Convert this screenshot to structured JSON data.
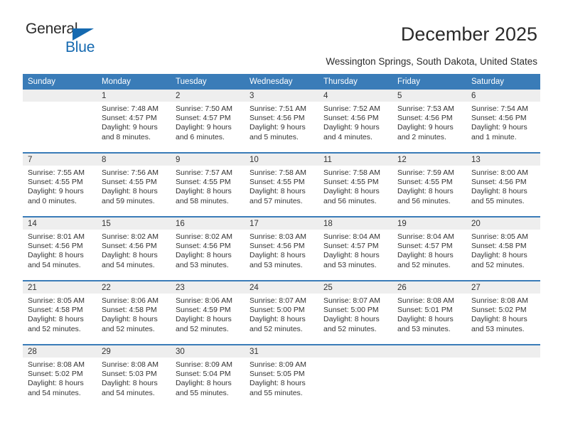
{
  "brand": {
    "name_top": "General",
    "name_bottom": "Blue",
    "accent_color": "#1569b0"
  },
  "header": {
    "title": "December 2025",
    "subtitle": "Wessington Springs, South Dakota, United States"
  },
  "calendar": {
    "header_bg": "#3a7cb8",
    "daynum_bg": "#eeeeee",
    "weekday_labels": [
      "Sunday",
      "Monday",
      "Tuesday",
      "Wednesday",
      "Thursday",
      "Friday",
      "Saturday"
    ],
    "weeks": [
      [
        {
          "day": "",
          "sunrise": "",
          "sunset": "",
          "daylight": "",
          "empty": true
        },
        {
          "day": "1",
          "sunrise": "Sunrise: 7:48 AM",
          "sunset": "Sunset: 4:57 PM",
          "daylight": "Daylight: 9 hours and 8 minutes."
        },
        {
          "day": "2",
          "sunrise": "Sunrise: 7:50 AM",
          "sunset": "Sunset: 4:57 PM",
          "daylight": "Daylight: 9 hours and 6 minutes."
        },
        {
          "day": "3",
          "sunrise": "Sunrise: 7:51 AM",
          "sunset": "Sunset: 4:56 PM",
          "daylight": "Daylight: 9 hours and 5 minutes."
        },
        {
          "day": "4",
          "sunrise": "Sunrise: 7:52 AM",
          "sunset": "Sunset: 4:56 PM",
          "daylight": "Daylight: 9 hours and 4 minutes."
        },
        {
          "day": "5",
          "sunrise": "Sunrise: 7:53 AM",
          "sunset": "Sunset: 4:56 PM",
          "daylight": "Daylight: 9 hours and 2 minutes."
        },
        {
          "day": "6",
          "sunrise": "Sunrise: 7:54 AM",
          "sunset": "Sunset: 4:56 PM",
          "daylight": "Daylight: 9 hours and 1 minute."
        }
      ],
      [
        {
          "day": "7",
          "sunrise": "Sunrise: 7:55 AM",
          "sunset": "Sunset: 4:55 PM",
          "daylight": "Daylight: 9 hours and 0 minutes."
        },
        {
          "day": "8",
          "sunrise": "Sunrise: 7:56 AM",
          "sunset": "Sunset: 4:55 PM",
          "daylight": "Daylight: 8 hours and 59 minutes."
        },
        {
          "day": "9",
          "sunrise": "Sunrise: 7:57 AM",
          "sunset": "Sunset: 4:55 PM",
          "daylight": "Daylight: 8 hours and 58 minutes."
        },
        {
          "day": "10",
          "sunrise": "Sunrise: 7:58 AM",
          "sunset": "Sunset: 4:55 PM",
          "daylight": "Daylight: 8 hours and 57 minutes."
        },
        {
          "day": "11",
          "sunrise": "Sunrise: 7:58 AM",
          "sunset": "Sunset: 4:55 PM",
          "daylight": "Daylight: 8 hours and 56 minutes."
        },
        {
          "day": "12",
          "sunrise": "Sunrise: 7:59 AM",
          "sunset": "Sunset: 4:55 PM",
          "daylight": "Daylight: 8 hours and 56 minutes."
        },
        {
          "day": "13",
          "sunrise": "Sunrise: 8:00 AM",
          "sunset": "Sunset: 4:56 PM",
          "daylight": "Daylight: 8 hours and 55 minutes."
        }
      ],
      [
        {
          "day": "14",
          "sunrise": "Sunrise: 8:01 AM",
          "sunset": "Sunset: 4:56 PM",
          "daylight": "Daylight: 8 hours and 54 minutes."
        },
        {
          "day": "15",
          "sunrise": "Sunrise: 8:02 AM",
          "sunset": "Sunset: 4:56 PM",
          "daylight": "Daylight: 8 hours and 54 minutes."
        },
        {
          "day": "16",
          "sunrise": "Sunrise: 8:02 AM",
          "sunset": "Sunset: 4:56 PM",
          "daylight": "Daylight: 8 hours and 53 minutes."
        },
        {
          "day": "17",
          "sunrise": "Sunrise: 8:03 AM",
          "sunset": "Sunset: 4:56 PM",
          "daylight": "Daylight: 8 hours and 53 minutes."
        },
        {
          "day": "18",
          "sunrise": "Sunrise: 8:04 AM",
          "sunset": "Sunset: 4:57 PM",
          "daylight": "Daylight: 8 hours and 53 minutes."
        },
        {
          "day": "19",
          "sunrise": "Sunrise: 8:04 AM",
          "sunset": "Sunset: 4:57 PM",
          "daylight": "Daylight: 8 hours and 52 minutes."
        },
        {
          "day": "20",
          "sunrise": "Sunrise: 8:05 AM",
          "sunset": "Sunset: 4:58 PM",
          "daylight": "Daylight: 8 hours and 52 minutes."
        }
      ],
      [
        {
          "day": "21",
          "sunrise": "Sunrise: 8:05 AM",
          "sunset": "Sunset: 4:58 PM",
          "daylight": "Daylight: 8 hours and 52 minutes."
        },
        {
          "day": "22",
          "sunrise": "Sunrise: 8:06 AM",
          "sunset": "Sunset: 4:58 PM",
          "daylight": "Daylight: 8 hours and 52 minutes."
        },
        {
          "day": "23",
          "sunrise": "Sunrise: 8:06 AM",
          "sunset": "Sunset: 4:59 PM",
          "daylight": "Daylight: 8 hours and 52 minutes."
        },
        {
          "day": "24",
          "sunrise": "Sunrise: 8:07 AM",
          "sunset": "Sunset: 5:00 PM",
          "daylight": "Daylight: 8 hours and 52 minutes."
        },
        {
          "day": "25",
          "sunrise": "Sunrise: 8:07 AM",
          "sunset": "Sunset: 5:00 PM",
          "daylight": "Daylight: 8 hours and 52 minutes."
        },
        {
          "day": "26",
          "sunrise": "Sunrise: 8:08 AM",
          "sunset": "Sunset: 5:01 PM",
          "daylight": "Daylight: 8 hours and 53 minutes."
        },
        {
          "day": "27",
          "sunrise": "Sunrise: 8:08 AM",
          "sunset": "Sunset: 5:02 PM",
          "daylight": "Daylight: 8 hours and 53 minutes."
        }
      ],
      [
        {
          "day": "28",
          "sunrise": "Sunrise: 8:08 AM",
          "sunset": "Sunset: 5:02 PM",
          "daylight": "Daylight: 8 hours and 54 minutes."
        },
        {
          "day": "29",
          "sunrise": "Sunrise: 8:08 AM",
          "sunset": "Sunset: 5:03 PM",
          "daylight": "Daylight: 8 hours and 54 minutes."
        },
        {
          "day": "30",
          "sunrise": "Sunrise: 8:09 AM",
          "sunset": "Sunset: 5:04 PM",
          "daylight": "Daylight: 8 hours and 55 minutes."
        },
        {
          "day": "31",
          "sunrise": "Sunrise: 8:09 AM",
          "sunset": "Sunset: 5:05 PM",
          "daylight": "Daylight: 8 hours and 55 minutes."
        },
        {
          "day": "",
          "sunrise": "",
          "sunset": "",
          "daylight": "",
          "empty": true
        },
        {
          "day": "",
          "sunrise": "",
          "sunset": "",
          "daylight": "",
          "empty": true
        },
        {
          "day": "",
          "sunrise": "",
          "sunset": "",
          "daylight": "",
          "empty": true
        }
      ]
    ]
  }
}
